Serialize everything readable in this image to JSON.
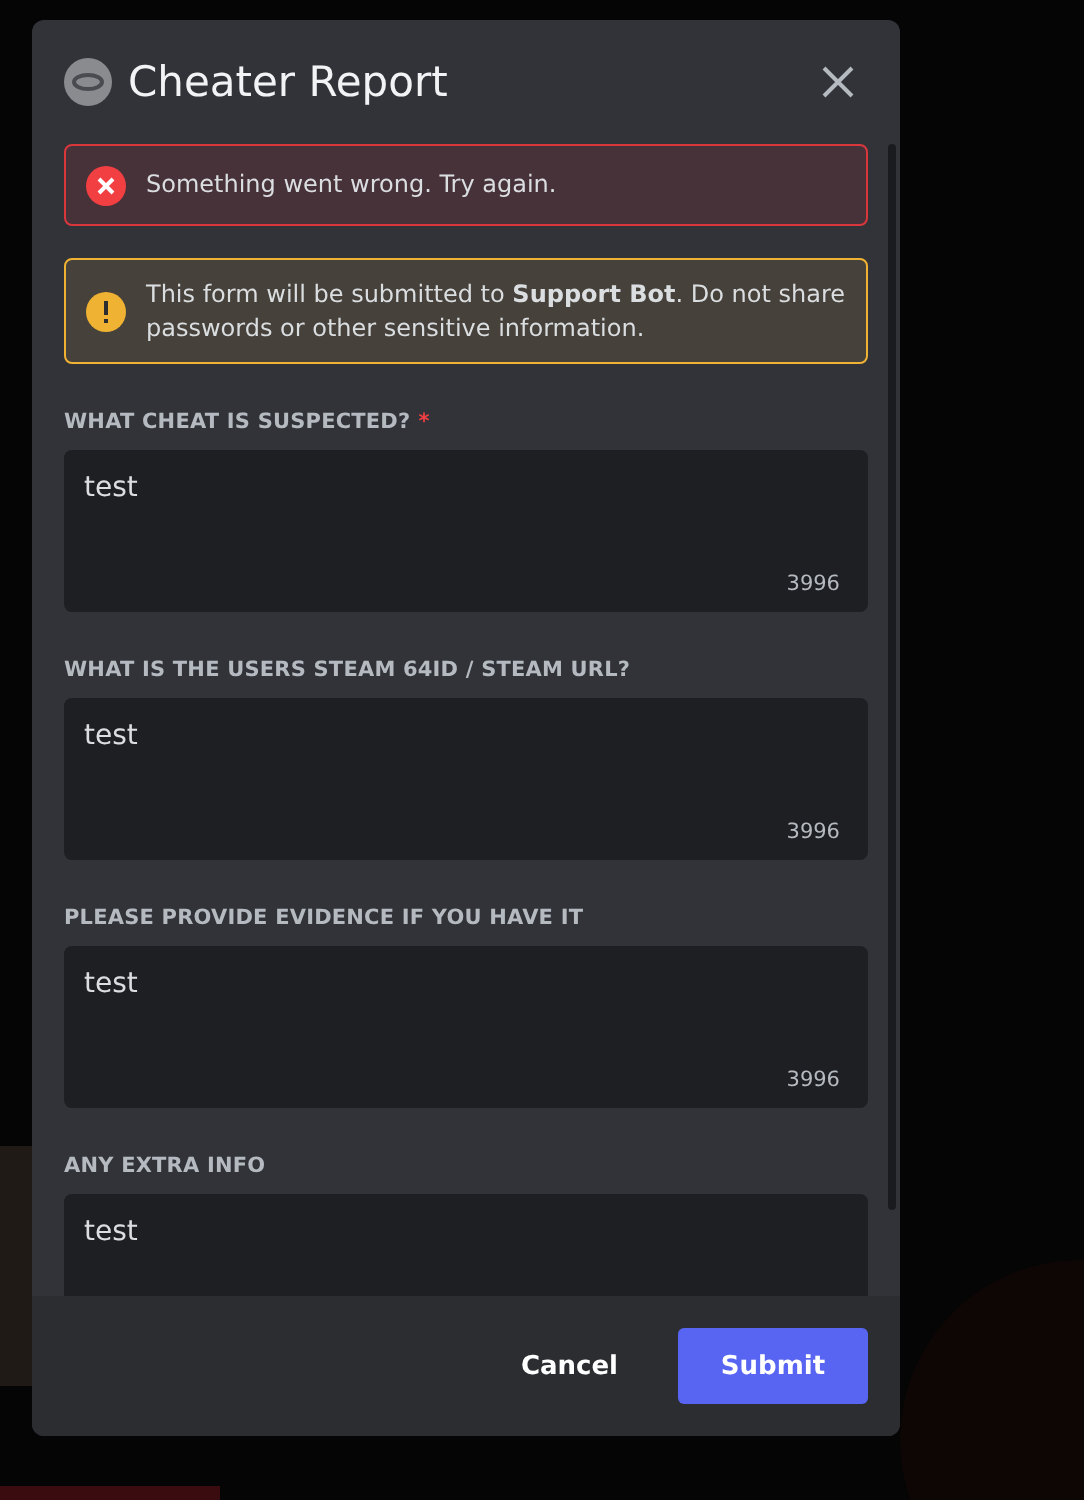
{
  "dialog": {
    "title": "Cheater Report",
    "error": "Something went wrong. Try again.",
    "notice": "This form will be submitted to **Support Bot**. Do not share passwords or other sensitive information.",
    "fields": [
      {
        "label": "WHAT CHEAT IS SUSPECTED?",
        "required_mark": "*",
        "value": "test",
        "counter": "3996"
      },
      {
        "label": "WHAT IS THE USERS STEAM 64ID / STEAM URL?",
        "value": "test",
        "counter": "3996"
      },
      {
        "label": "PLEASE PROVIDE EVIDENCE IF YOU HAVE IT",
        "value": "test",
        "counter": "3996"
      },
      {
        "label": "ANY EXTRA INFO",
        "value": "test"
      }
    ],
    "buttons": [
      {
        "label": "Cancel",
        "kind": "link"
      },
      {
        "label": "Submit",
        "kind": "primary"
      }
    ]
  }
}
